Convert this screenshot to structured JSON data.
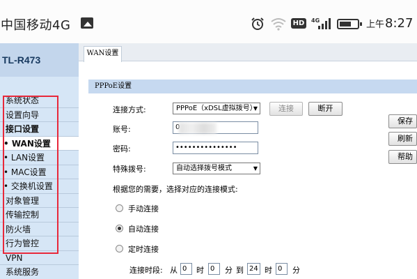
{
  "status_bar": {
    "carrier": "中国移动4G",
    "network_label": "4G",
    "hd_label": "HD",
    "ampm": "上午",
    "time": "8:27",
    "icons": [
      "gallery-icon",
      "alarm-icon",
      "wifi-icon",
      "hd-icon",
      "signal-icon",
      "battery-icon"
    ]
  },
  "sidebar": {
    "brand": "TL-R473",
    "items": [
      {
        "label": "系统状态",
        "bold": false
      },
      {
        "label": "设置向导",
        "bold": false
      },
      {
        "label": "接口设置",
        "bold": true
      },
      {
        "label": "• WAN设置",
        "bold": true
      },
      {
        "label": "• LAN设置",
        "bold": false
      },
      {
        "label": "• MAC设置",
        "bold": false
      },
      {
        "label": "• 交换机设置",
        "bold": false
      },
      {
        "label": "对象管理",
        "bold": false
      },
      {
        "label": "传输控制",
        "bold": false
      },
      {
        "label": "防火墙",
        "bold": false
      },
      {
        "label": "行为管控",
        "bold": false
      },
      {
        "label": "VPN",
        "bold": false
      },
      {
        "label": "系统服务",
        "bold": false
      }
    ],
    "active_index": 3,
    "highlight_color": "#e8283a"
  },
  "tab": {
    "label": "WAN设置"
  },
  "form": {
    "section_title": "PPPoE设置",
    "connection_type_label": "连接方式:",
    "connection_type_value": "PPPoE（xDSL虚拟拨号）",
    "connect_button": "连接",
    "disconnect_button": "断开",
    "account_label": "账号:",
    "account_value": "0",
    "password_label": "密码:",
    "password_value": "•••••••••••••••",
    "dial_label": "特殊拨号:",
    "dial_value": "自动选择拨号模式",
    "mode_prompt": "根据您的需要，选择对应的连接模式:",
    "modes": [
      {
        "label": "手动连接",
        "checked": false
      },
      {
        "label": "自动连接",
        "checked": true
      },
      {
        "label": "定时连接",
        "checked": false
      }
    ],
    "schedule": {
      "label": "连接时段:",
      "from": "从",
      "from_hour": "0",
      "hour_unit": "时",
      "from_minute": "0",
      "minute_unit": "分",
      "to": "到",
      "to_hour": "24",
      "to_minute": "0"
    }
  },
  "side_buttons": {
    "save": "保存",
    "refresh": "刷新",
    "help": "帮助"
  }
}
